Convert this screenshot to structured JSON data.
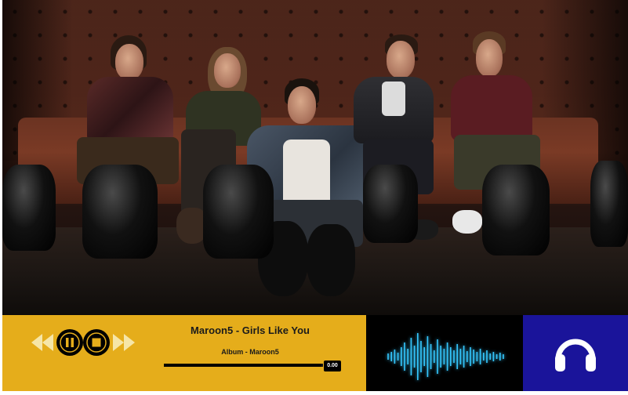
{
  "cover_art": {
    "description_name": "band-photo"
  },
  "player": {
    "song_title": "Maroon5 - Girls Like You",
    "album": "Album - Maroon5",
    "time": "0.00",
    "progress": 0.99,
    "colors": {
      "player_bg": "#e5ad1b",
      "visualizer_bg": "#000000",
      "visualizer_wave": "#35c8ff",
      "headphone_bg": "#1a149a"
    },
    "controls": [
      {
        "icon": "rewind-icon"
      },
      {
        "icon": "pause-icon"
      },
      {
        "icon": "stop-icon"
      },
      {
        "icon": "fast-forward-icon"
      }
    ]
  },
  "visualizer": {
    "icon": "audio-waveform-icon"
  },
  "headphone": {
    "icon": "headphones-icon"
  }
}
